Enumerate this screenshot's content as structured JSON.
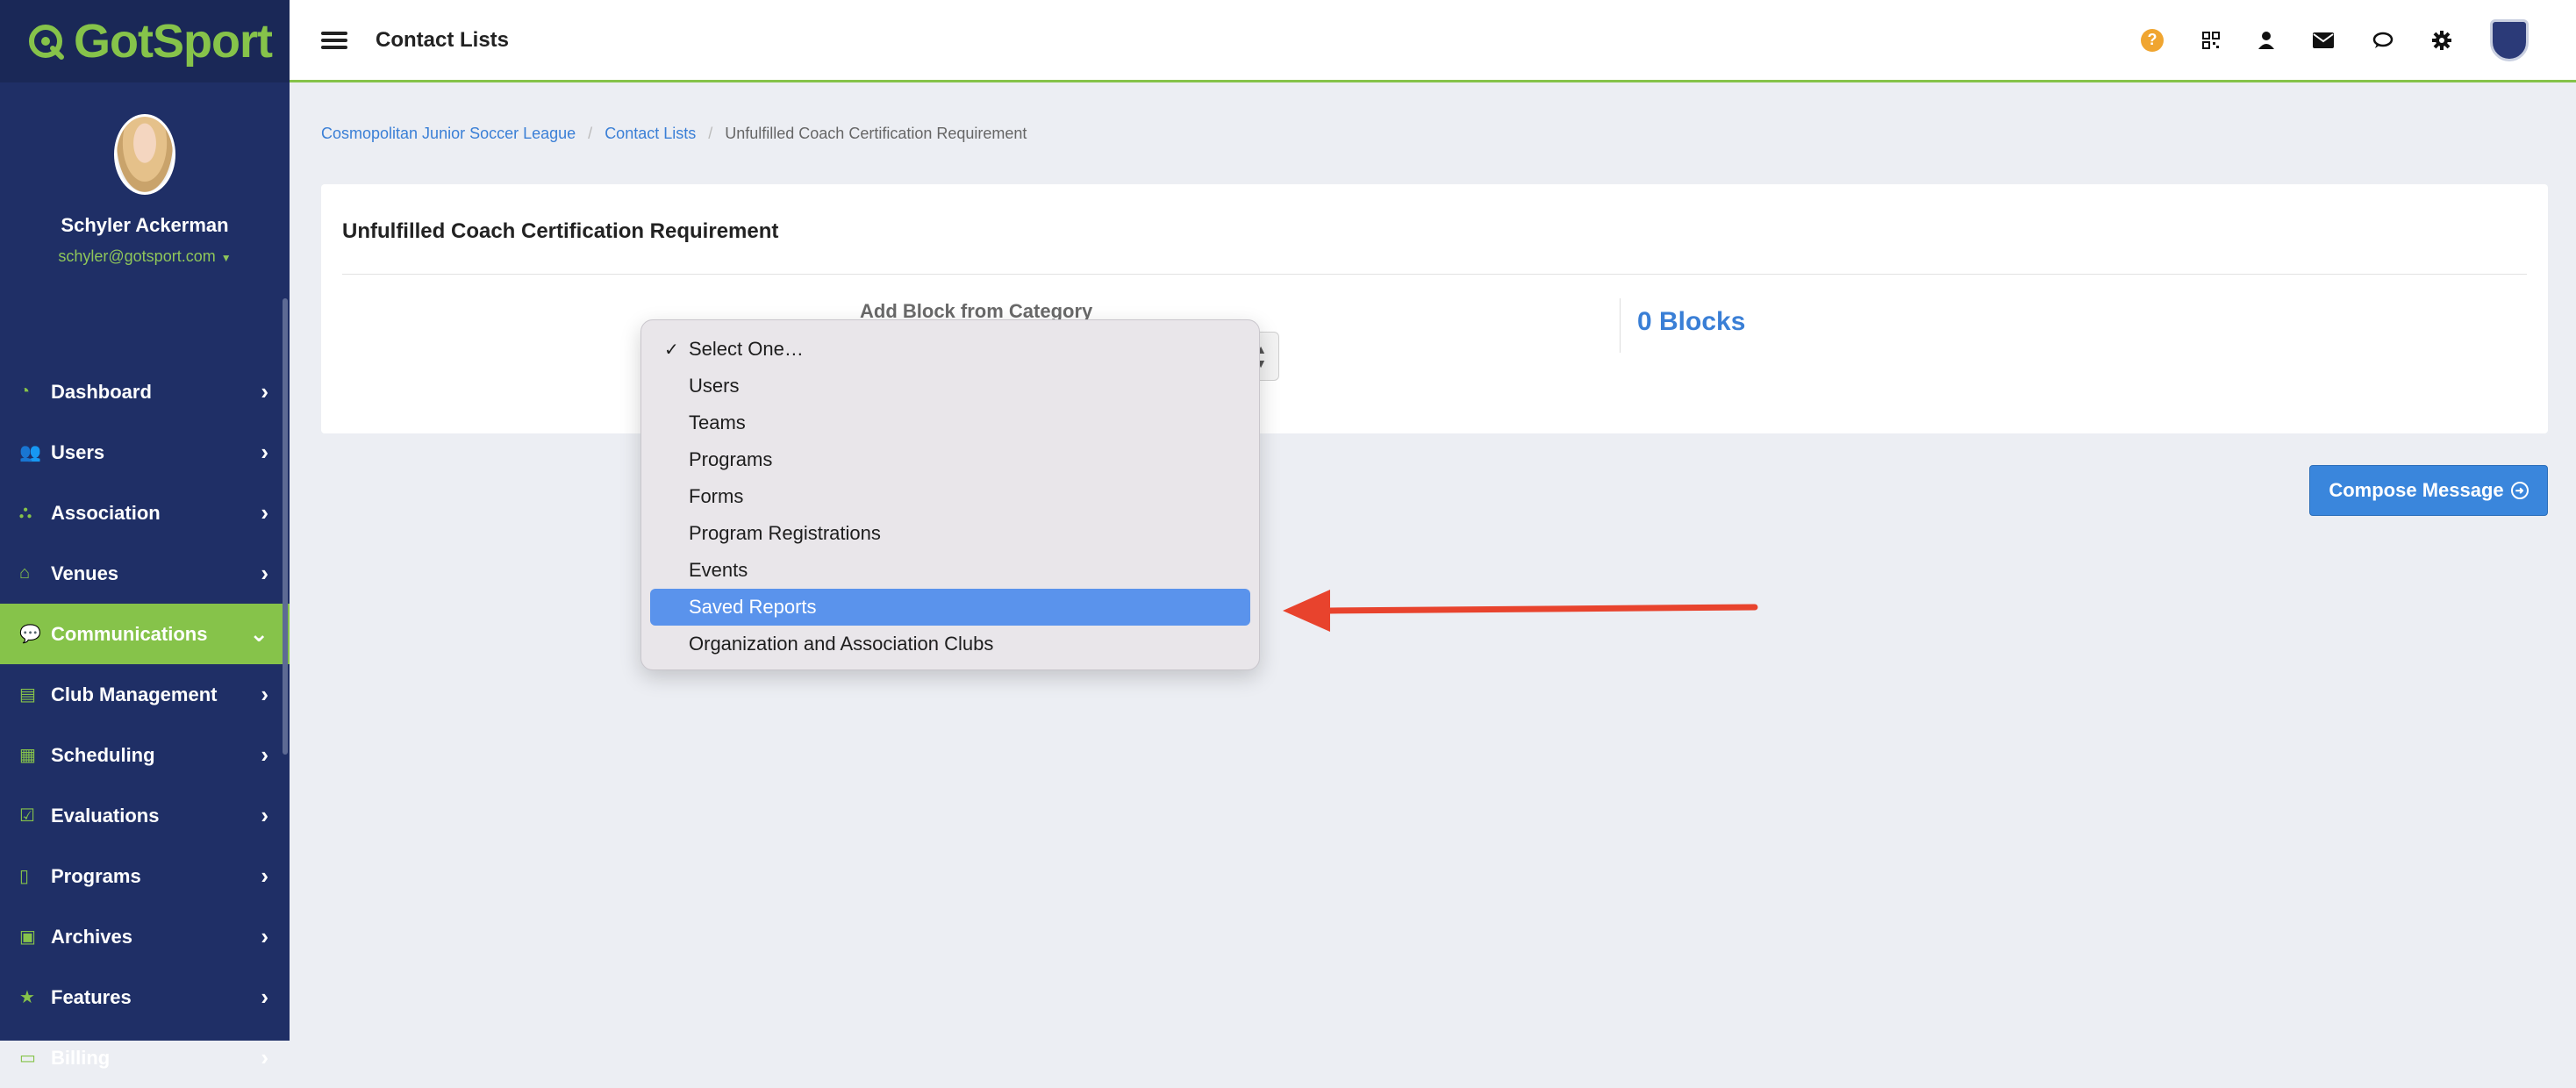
{
  "app": {
    "logo_text": "GotSport"
  },
  "user": {
    "name": "Schyler Ackerman",
    "email": "schyler@gotsport.com"
  },
  "sidebar": {
    "items": [
      {
        "label": "Dashboard",
        "icon": "dashboard-icon"
      },
      {
        "label": "Users",
        "icon": "users-icon"
      },
      {
        "label": "Association",
        "icon": "sitemap-icon"
      },
      {
        "label": "Venues",
        "icon": "home-icon"
      },
      {
        "label": "Communications",
        "icon": "chat-icon",
        "active": true
      },
      {
        "label": "Club Management",
        "icon": "club-icon"
      },
      {
        "label": "Scheduling",
        "icon": "schedule-icon"
      },
      {
        "label": "Evaluations",
        "icon": "calendar-check-icon"
      },
      {
        "label": "Programs",
        "icon": "document-icon"
      },
      {
        "label": "Archives",
        "icon": "archive-icon"
      },
      {
        "label": "Features",
        "icon": "star-icon"
      },
      {
        "label": "Billing",
        "icon": "credit-card-icon"
      }
    ]
  },
  "topbar": {
    "title": "Contact Lists",
    "help_glyph": "?"
  },
  "breadcrumb": [
    "Cosmopolitan Junior Soccer League",
    "Contact Lists",
    "Unfulfilled Coach Certification Requirement"
  ],
  "card": {
    "title": "Unfulfilled Coach Certification Requirement",
    "field_label": "Add Block from Category",
    "blocks_count": "0 Blocks"
  },
  "compose_button": {
    "label": "Compose Message"
  },
  "dropdown": {
    "checked_glyph": "✓",
    "options": [
      "Select One…",
      "Users",
      "Teams",
      "Programs",
      "Forms",
      "Program Registrations",
      "Events",
      "Saved Reports",
      "Organization and Association Clubs"
    ],
    "checked_index": 0,
    "highlighted_index": 7
  },
  "colors": {
    "sidebar_bg": "#1f2f66",
    "brand_green": "#86c34a",
    "link_blue": "#3a7fd6",
    "highlight_blue": "#5a93ec",
    "arrow_red": "#e8432d"
  }
}
